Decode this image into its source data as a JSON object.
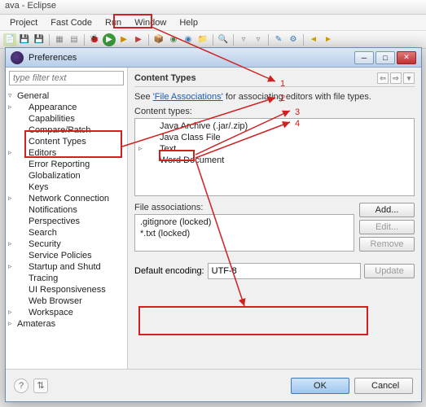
{
  "main_window": {
    "title": "ava - Eclipse"
  },
  "menubar": {
    "items": [
      "Project",
      "Fast Code",
      "Run",
      "Window",
      "Help"
    ]
  },
  "dialog": {
    "title": "Preferences",
    "filter_placeholder": "type filter text",
    "tree": {
      "root": "General",
      "children": [
        {
          "label": "Appearance",
          "children": true
        },
        {
          "label": "Capabilities"
        },
        {
          "label": "Compare/Patch"
        },
        {
          "label": "Content Types"
        },
        {
          "label": "Editors",
          "children": true
        },
        {
          "label": "Error Reporting"
        },
        {
          "label": "Globalization"
        },
        {
          "label": "Keys"
        },
        {
          "label": "Network Connection",
          "children": true
        },
        {
          "label": "Notifications"
        },
        {
          "label": "Perspectives"
        },
        {
          "label": "Search"
        },
        {
          "label": "Security",
          "children": true
        },
        {
          "label": "Service Policies"
        },
        {
          "label": "Startup and Shutd",
          "children": true
        },
        {
          "label": "Tracing"
        },
        {
          "label": "UI Responsiveness"
        },
        {
          "label": "Web Browser"
        },
        {
          "label": "Workspace",
          "children": true
        }
      ],
      "root2": "Amateras"
    },
    "right": {
      "title": "Content Types",
      "intro_prefix": "See ",
      "intro_link": "'File Associations'",
      "intro_suffix": " for associating editors with file types.",
      "content_types_label": "Content types:",
      "content_types": [
        {
          "label": "Java Archive (.jar/.zip)"
        },
        {
          "label": "Java Class File"
        },
        {
          "label": "Text",
          "children": true
        },
        {
          "label": "Word Document"
        }
      ],
      "file_assoc_label": "File associations:",
      "file_assoc": [
        ".gitignore (locked)",
        "*.txt (locked)"
      ],
      "buttons": {
        "add": "Add...",
        "edit": "Edit...",
        "remove": "Remove",
        "update": "Update"
      },
      "encoding_label": "Default encoding:",
      "encoding_value": "UTF-8"
    },
    "bottom": {
      "ok": "OK",
      "cancel": "Cancel"
    }
  },
  "annotations": {
    "labels": [
      "1",
      "2",
      "3",
      "4"
    ]
  }
}
